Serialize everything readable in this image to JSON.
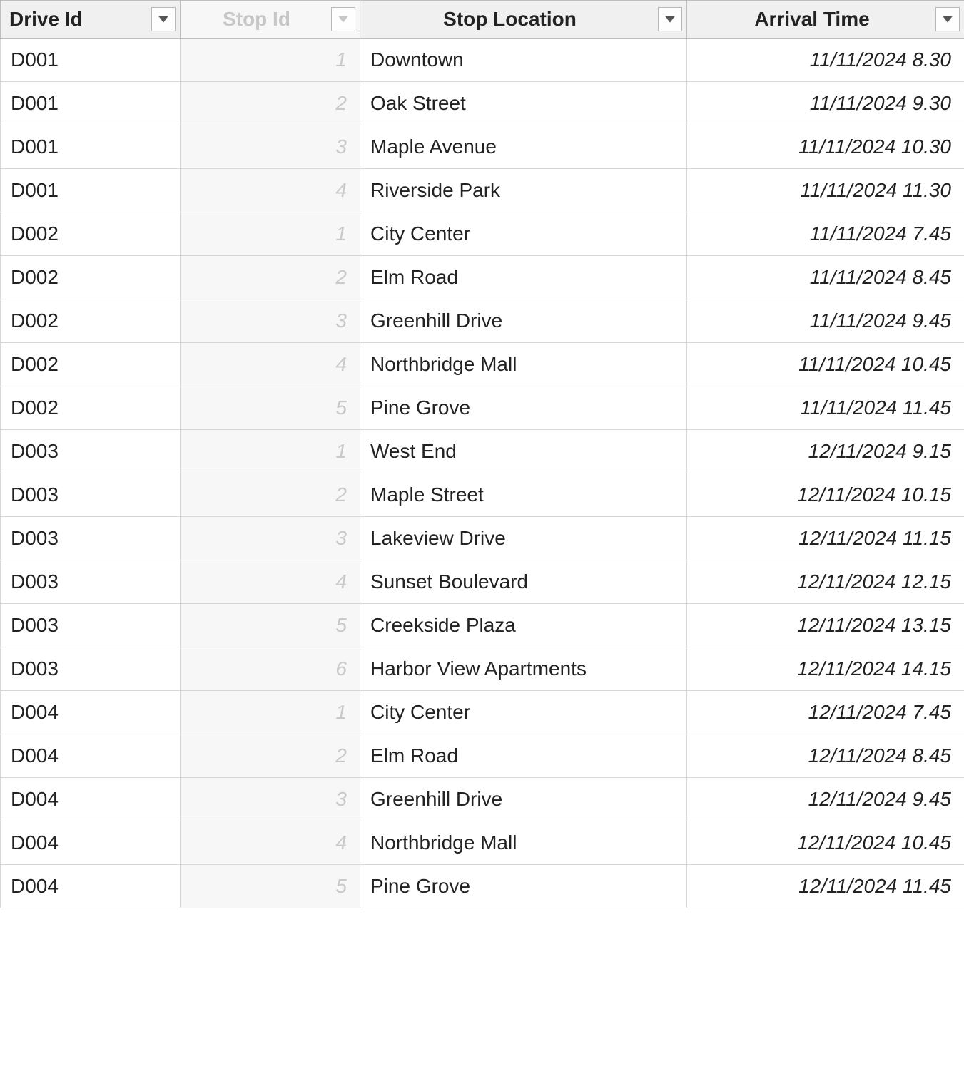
{
  "table": {
    "headers": {
      "drive_id": "Drive Id",
      "stop_id": "Stop Id",
      "stop_location": "Stop Location",
      "arrival_time": "Arrival Time"
    },
    "rows": [
      {
        "drive_id": "D001",
        "stop_id": "1",
        "stop_location": "Downtown",
        "arrival_time": "11/11/2024 8.30"
      },
      {
        "drive_id": "D001",
        "stop_id": "2",
        "stop_location": "Oak Street",
        "arrival_time": "11/11/2024 9.30"
      },
      {
        "drive_id": "D001",
        "stop_id": "3",
        "stop_location": "Maple Avenue",
        "arrival_time": "11/11/2024 10.30"
      },
      {
        "drive_id": "D001",
        "stop_id": "4",
        "stop_location": "Riverside Park",
        "arrival_time": "11/11/2024 11.30"
      },
      {
        "drive_id": "D002",
        "stop_id": "1",
        "stop_location": "City Center",
        "arrival_time": "11/11/2024 7.45"
      },
      {
        "drive_id": "D002",
        "stop_id": "2",
        "stop_location": "Elm Road",
        "arrival_time": "11/11/2024 8.45"
      },
      {
        "drive_id": "D002",
        "stop_id": "3",
        "stop_location": "Greenhill Drive",
        "arrival_time": "11/11/2024 9.45"
      },
      {
        "drive_id": "D002",
        "stop_id": "4",
        "stop_location": "Northbridge Mall",
        "arrival_time": "11/11/2024 10.45"
      },
      {
        "drive_id": "D002",
        "stop_id": "5",
        "stop_location": "Pine Grove",
        "arrival_time": "11/11/2024 11.45"
      },
      {
        "drive_id": "D003",
        "stop_id": "1",
        "stop_location": "West End",
        "arrival_time": "12/11/2024 9.15"
      },
      {
        "drive_id": "D003",
        "stop_id": "2",
        "stop_location": "Maple Street",
        "arrival_time": "12/11/2024 10.15"
      },
      {
        "drive_id": "D003",
        "stop_id": "3",
        "stop_location": "Lakeview Drive",
        "arrival_time": "12/11/2024 11.15"
      },
      {
        "drive_id": "D003",
        "stop_id": "4",
        "stop_location": "Sunset Boulevard",
        "arrival_time": "12/11/2024 12.15"
      },
      {
        "drive_id": "D003",
        "stop_id": "5",
        "stop_location": "Creekside Plaza",
        "arrival_time": "12/11/2024 13.15"
      },
      {
        "drive_id": "D003",
        "stop_id": "6",
        "stop_location": "Harbor View Apartments",
        "arrival_time": "12/11/2024 14.15"
      },
      {
        "drive_id": "D004",
        "stop_id": "1",
        "stop_location": "City Center",
        "arrival_time": "12/11/2024 7.45"
      },
      {
        "drive_id": "D004",
        "stop_id": "2",
        "stop_location": "Elm Road",
        "arrival_time": "12/11/2024 8.45"
      },
      {
        "drive_id": "D004",
        "stop_id": "3",
        "stop_location": "Greenhill Drive",
        "arrival_time": "12/11/2024 9.45"
      },
      {
        "drive_id": "D004",
        "stop_id": "4",
        "stop_location": "Northbridge Mall",
        "arrival_time": "12/11/2024 10.45"
      },
      {
        "drive_id": "D004",
        "stop_id": "5",
        "stop_location": "Pine Grove",
        "arrival_time": "12/11/2024 11.45"
      }
    ]
  }
}
